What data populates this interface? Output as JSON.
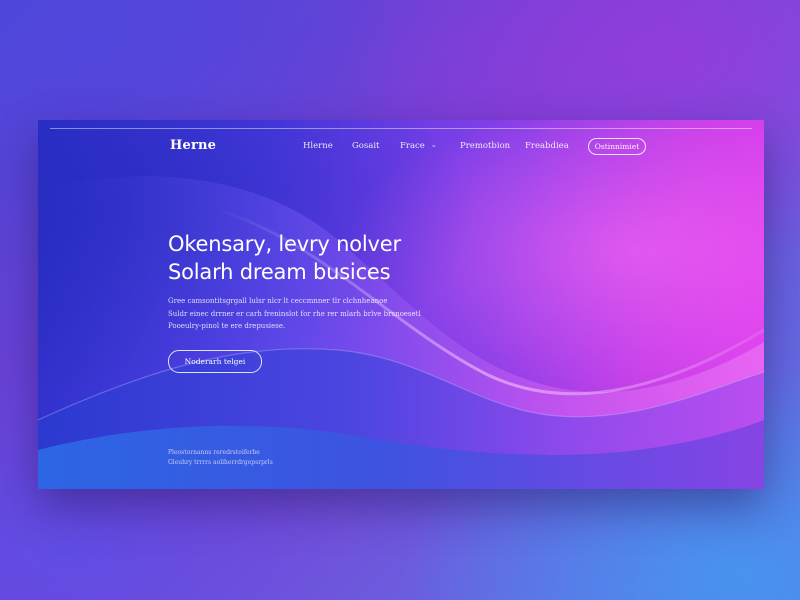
{
  "nav": {
    "logo": "Herne",
    "items": [
      {
        "label": "Hlerne"
      },
      {
        "label": "Gosait"
      },
      {
        "label": "Frace",
        "has_dropdown": true
      },
      {
        "label": "Premotbion"
      },
      {
        "label": "Freabdiea"
      }
    ],
    "cta_label": "Ostinnimiet"
  },
  "hero": {
    "title_lines": [
      "Okensary, levry nolver",
      "Solarh dream busices"
    ],
    "body_lines": [
      "Gree camsontitsgrgall lulsr nlcr lt ceccmnner tlr clchnheanoe",
      "Suldr einec drrner er carh freninslot for rhe rer mlarh brlve brsnoesetl",
      "Pooeulry-pinol te ere drepusiese."
    ],
    "cta_label": "Noderarh telgei"
  },
  "footnote": {
    "lines": [
      "Pleostornanns reredrstoiferbe",
      "Gleuhry trrrrs aoliherrdrgepsrprls"
    ]
  },
  "icons": {
    "dropdown": "chevron-down-icon"
  },
  "colors": {
    "frame_left": "#2b2fc7",
    "frame_right": "#e13ff0",
    "text": "#ffffff"
  }
}
